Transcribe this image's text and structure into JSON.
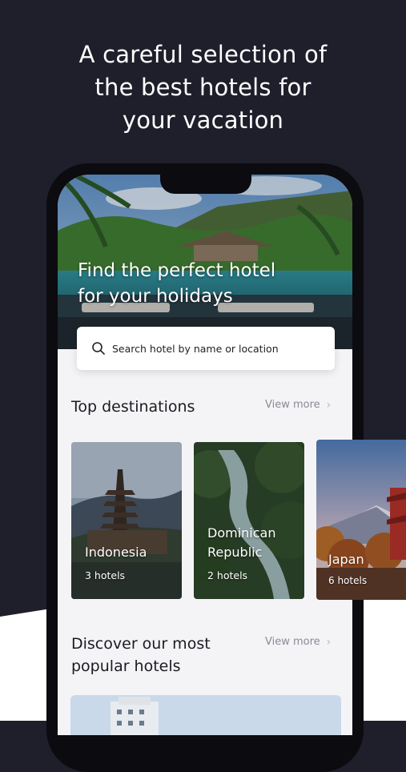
{
  "promo": {
    "headline_lines": [
      "A careful selection of",
      "the best hotels for",
      "your vacation"
    ]
  },
  "app": {
    "hero": {
      "title_lines": [
        "Find the perfect hotel",
        "for your holidays"
      ]
    },
    "search": {
      "placeholder": "Search hotel by name or location"
    },
    "top_destinations": {
      "title": "Top destinations",
      "view_more": "View more",
      "cards": [
        {
          "name_lines": [
            "Indonesia"
          ],
          "count": "3 hotels"
        },
        {
          "name_lines": [
            "Dominican",
            "Republic"
          ],
          "count": "2 hotels"
        },
        {
          "name_lines": [
            "Japan"
          ],
          "count": "6 hotels"
        }
      ]
    },
    "popular": {
      "title_lines": [
        "Discover our most",
        "popular hotels"
      ],
      "view_more": "View more"
    }
  },
  "icons": {
    "search": "search-icon",
    "chevron": "chevron-right-icon"
  },
  "colors": {
    "dark_background": "#1f1f2b",
    "light_background": "#f4f4f6",
    "text_primary": "#1b1b22",
    "text_muted": "#8a8a95"
  }
}
